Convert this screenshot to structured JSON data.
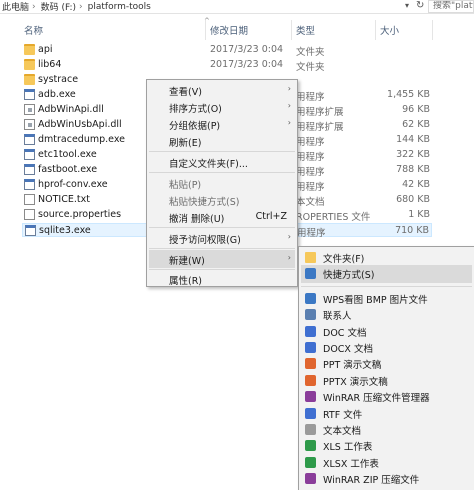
{
  "address": {
    "parts": [
      "此电脑",
      "数码 (F:)",
      "platform-tools"
    ],
    "search_placeholder": "搜索\"platf"
  },
  "columns": {
    "name": "名称",
    "date": "修改日期",
    "type": "类型",
    "size": "大小"
  },
  "files": [
    {
      "name": "api",
      "date": "2017/3/23 0:04",
      "type": "文件夹",
      "size": "",
      "icon": "folder-icon"
    },
    {
      "name": "lib64",
      "date": "2017/3/23 0:04",
      "type": "文件夹",
      "size": "",
      "icon": "folder-icon"
    },
    {
      "name": "systrace",
      "date": "",
      "type": "",
      "size": "",
      "icon": "folder-icon"
    },
    {
      "name": "adb.exe",
      "date": "",
      "type": "用程序",
      "size": "1,455 KB",
      "icon": "exe-icon"
    },
    {
      "name": "AdbWinApi.dll",
      "date": "",
      "type": "用程序扩展",
      "size": "96 KB",
      "icon": "dll-icon"
    },
    {
      "name": "AdbWinUsbApi.dll",
      "date": "",
      "type": "用程序扩展",
      "size": "62 KB",
      "icon": "dll-icon"
    },
    {
      "name": "dmtracedump.exe",
      "date": "",
      "type": "用程序",
      "size": "144 KB",
      "icon": "exe-icon"
    },
    {
      "name": "etc1tool.exe",
      "date": "",
      "type": "用程序",
      "size": "322 KB",
      "icon": "exe-icon"
    },
    {
      "name": "fastboot.exe",
      "date": "",
      "type": "用程序",
      "size": "788 KB",
      "icon": "exe-icon"
    },
    {
      "name": "hprof-conv.exe",
      "date": "",
      "type": "用程序",
      "size": "42 KB",
      "icon": "exe-icon"
    },
    {
      "name": "NOTICE.txt",
      "date": "",
      "type": "本文档",
      "size": "680 KB",
      "icon": "file-icon"
    },
    {
      "name": "source.properties",
      "date": "",
      "type": "ROPERTIES 文件",
      "size": "1 KB",
      "icon": "file-icon"
    },
    {
      "name": "sqlite3.exe",
      "date": "",
      "type": "用程序",
      "size": "710 KB",
      "icon": "exe-icon"
    }
  ],
  "context_menu": {
    "view": "查看(V)",
    "sort": "排序方式(O)",
    "group": "分组依据(P)",
    "refresh": "刷新(E)",
    "customize": "自定义文件夹(F)...",
    "paste": "粘贴(P)",
    "paste_shortcut": "粘贴快捷方式(S)",
    "undo": "撤消 删除(U)",
    "undo_shortcut": "Ctrl+Z",
    "grant": "授予访问权限(G)",
    "new": "新建(W)",
    "properties": "属性(R)"
  },
  "new_submenu": [
    {
      "label": "文件夹(F)",
      "icon": "folder-icon",
      "color": "#f6c85a"
    },
    {
      "label": "快捷方式(S)",
      "icon": "shortcut-icon",
      "color": "#3b78c4"
    },
    {
      "label": "WPS看图 BMP 图片文件",
      "icon": "image-icon",
      "color": "#3b78c4"
    },
    {
      "label": "联系人",
      "icon": "contact-icon",
      "color": "#5a7fb0"
    },
    {
      "label": "DOC 文档",
      "icon": "doc-icon",
      "color": "#3f6fd1"
    },
    {
      "label": "DOCX 文档",
      "icon": "docx-icon",
      "color": "#3f6fd1"
    },
    {
      "label": "PPT 演示文稿",
      "icon": "ppt-icon",
      "color": "#e0652e"
    },
    {
      "label": "PPTX 演示文稿",
      "icon": "pptx-icon",
      "color": "#e0652e"
    },
    {
      "label": "WinRAR 压缩文件管理器",
      "icon": "winrar-icon",
      "color": "#8a3d9a"
    },
    {
      "label": "RTF 文件",
      "icon": "rtf-icon",
      "color": "#3f6fd1"
    },
    {
      "label": "文本文档",
      "icon": "text-icon",
      "color": "#9a9a9a"
    },
    {
      "label": "XLS 工作表",
      "icon": "xls-icon",
      "color": "#2e9a4a"
    },
    {
      "label": "XLSX 工作表",
      "icon": "xlsx-icon",
      "color": "#2e9a4a"
    },
    {
      "label": "WinRAR ZIP 压缩文件",
      "icon": "winrar-zip-icon",
      "color": "#8a3d9a"
    }
  ]
}
